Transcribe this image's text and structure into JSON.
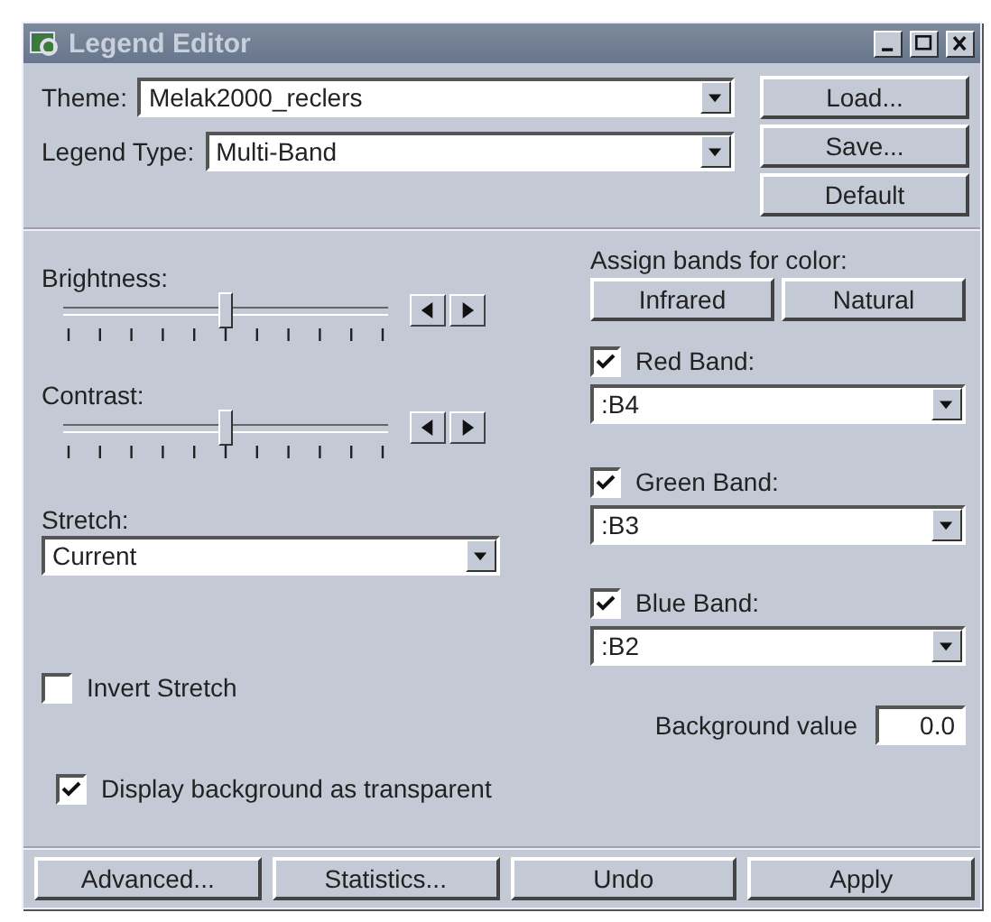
{
  "window": {
    "title": "Legend Editor"
  },
  "theme": {
    "label": "Theme:",
    "value": "Melak2000_reclers"
  },
  "legend_type": {
    "label": "Legend Type:",
    "value": "Multi-Band"
  },
  "file_buttons": [
    "Load...",
    "Save...",
    "Default"
  ],
  "sliders": [
    {
      "label": "Brightness:",
      "level": 0.5
    },
    {
      "label": "Contrast:",
      "level": 0.5
    }
  ],
  "stretch": {
    "label": "Stretch:",
    "value": "Current"
  },
  "assign": {
    "label": "Assign bands for color:",
    "buttons": [
      "Infrared",
      "Natural"
    ]
  },
  "bands": [
    {
      "label": "Red Band:",
      "checked": true,
      "value": ":B4"
    },
    {
      "label": "Green Band:",
      "checked": true,
      "value": ":B3"
    },
    {
      "label": "Blue Band:",
      "checked": true,
      "value": ":B2"
    }
  ],
  "invert_stretch": {
    "label": "Invert Stretch",
    "checked": false
  },
  "background_value": {
    "label": "Background value",
    "value": "0.0"
  },
  "display_transparent": {
    "label": "Display background as transparent",
    "checked": true
  },
  "buttons": [
    "Advanced...",
    "Statistics...",
    "Undo",
    "Apply"
  ]
}
